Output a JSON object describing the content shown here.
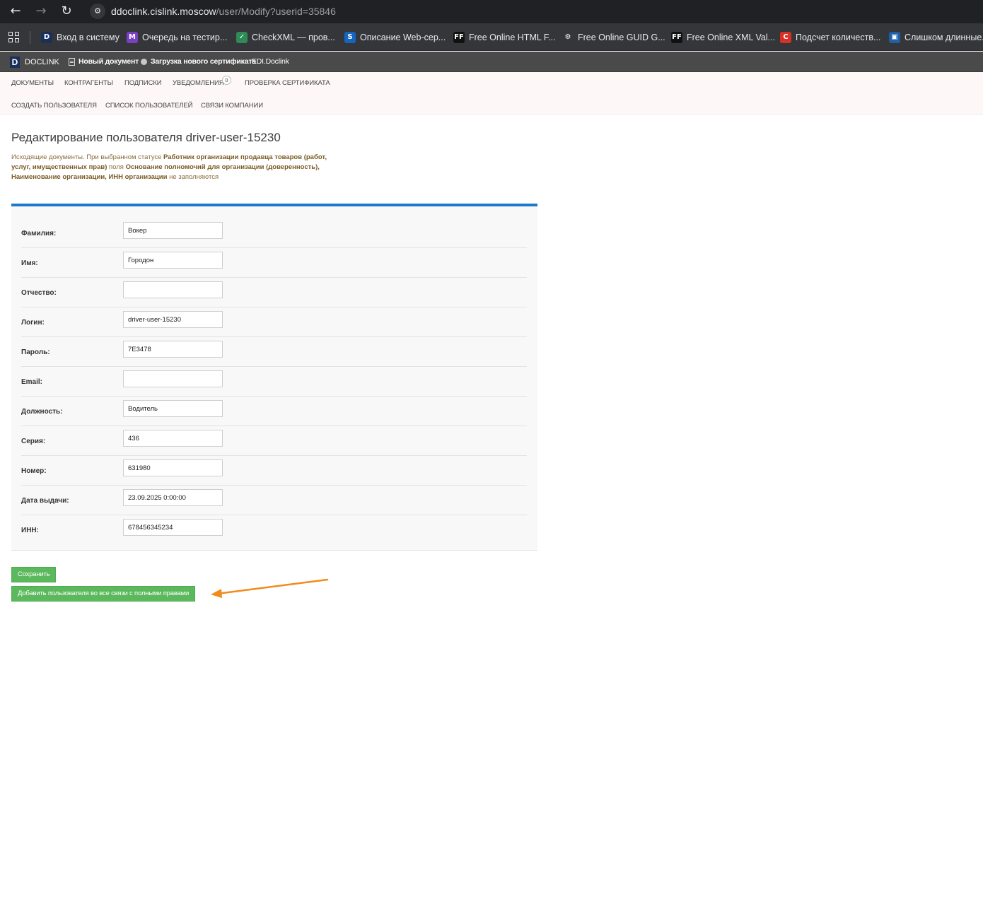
{
  "browser": {
    "url_host": "ddoclink.cislink.moscow",
    "url_path": "/user/Modify?userid=35846",
    "back_glyph": "←",
    "forward_glyph": "→",
    "reload_glyph": "↻",
    "bookmarks": [
      {
        "icon_text": "D",
        "icon_color": "#1a2f5a",
        "label": "Вход в систему"
      },
      {
        "icon_text": "M",
        "icon_color": "#7b3fc4",
        "label": "Очередь на тестир..."
      },
      {
        "icon_text": "✓",
        "icon_color": "#2e8b57",
        "label": "CheckXML — пров..."
      },
      {
        "icon_text": "S",
        "icon_color": "#1565c0",
        "label": "Описание Web-сер..."
      },
      {
        "icon_text": "FF",
        "icon_color": "#111111",
        "label": "Free Online HTML F..."
      },
      {
        "icon_text": "⚙",
        "icon_color": "#35363a",
        "label": "Free Online GUID G..."
      },
      {
        "icon_text": "FF",
        "icon_color": "#111111",
        "label": "Free Online XML Val..."
      },
      {
        "icon_text": "C",
        "icon_color": "#d93025",
        "label": "Подсчет количеств..."
      },
      {
        "icon_text": "▣",
        "icon_color": "#1e5fa8",
        "label": "Слишком длинные..."
      }
    ]
  },
  "appbar": {
    "logo_letter": "D",
    "app_name": "DOCLINK",
    "new_doc": "Новый документ",
    "upload_cert": "Загрузка нового сертификата",
    "edi": "EDI.Doclink"
  },
  "subnav": {
    "row1": [
      "ДОКУМЕНТЫ",
      "КОНТРАГЕНТЫ",
      "ПОДПИСКИ",
      "УВЕДОМЛЕНИЯ",
      "ПРОВЕРКА СЕРТИФИКАТА"
    ],
    "notifications_count": "0",
    "row2": [
      "СОЗДАТЬ ПОЛЬЗОВАТЕЛЯ",
      "СПИСОК ПОЛЬЗОВАТЕЛЕЙ",
      "СВЯЗИ КОМПАНИИ"
    ]
  },
  "page": {
    "title": "Редактирование пользователя driver-user-15230",
    "notice_1": "Исходящие документы. При выбранном статусе ",
    "notice_b1": "Работник организации продавца товаров (работ, услуг, имущественных прав)",
    "notice_2": " поля ",
    "notice_b2": "Основание полномочий для организации (доверенность), Наименование организации, ИНН организации",
    "notice_3": " не заполняются"
  },
  "form": {
    "fields": [
      {
        "label": "Фамилия:",
        "value": "Вокер"
      },
      {
        "label": "Имя:",
        "value": "Городон"
      },
      {
        "label": "Отчество:",
        "value": ""
      },
      {
        "label": "Логин:",
        "value": "driver-user-15230"
      },
      {
        "label": "Пароль:",
        "value": "7E3478"
      },
      {
        "label": "Email:",
        "value": ""
      },
      {
        "label": "Должность:",
        "value": "Водитель"
      },
      {
        "label": "Серия:",
        "value": "436"
      },
      {
        "label": "Номер:",
        "value": "631980"
      },
      {
        "label": "Дата выдачи:",
        "value": "23.09.2025 0:00:00"
      },
      {
        "label": "ИНН:",
        "value": "678456345234"
      }
    ],
    "save_label": "Сохранить",
    "add_all_label": "Добавить пользователя во все связи с полными правами"
  },
  "colors": {
    "accent": "#1e7ac9",
    "button_green": "#5cb85c",
    "annotation_arrow": "#f28a1c"
  }
}
